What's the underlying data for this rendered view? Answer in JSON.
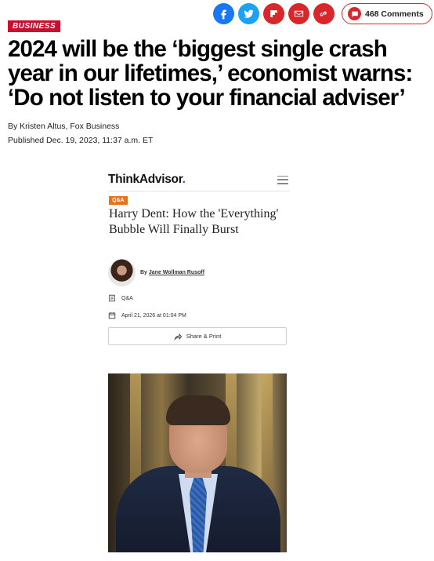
{
  "share_bar": {
    "buttons": [
      {
        "name": "facebook-icon"
      },
      {
        "name": "twitter-icon"
      },
      {
        "name": "flipboard-icon"
      },
      {
        "name": "email-icon"
      },
      {
        "name": "link-icon"
      }
    ],
    "comments_label": "468 Comments",
    "colors": {
      "facebook": "#1877f2",
      "twitter": "#1da1f2",
      "brand_red": "#d9262b"
    }
  },
  "article": {
    "section": "BUSINESS",
    "headline": "2024 will be the ‘biggest single crash year in our lifetimes,’ economist warns: ‘Do not listen to your financial adviser’",
    "byline_prefix": "By ",
    "author": "Kristen Altus",
    "outlet": ", Fox Business",
    "published": "Published Dec. 19, 2023, 11:37 a.m. ET"
  },
  "embed": {
    "logo_text": "ThinkAdvisor",
    "logo_dot": ".",
    "tag": "Q&A",
    "title": "Harry Dent: How the 'Everything' Bubble Will Finally Burst",
    "author_prefix": "By ",
    "author": "Jane Wollman Rusoff",
    "type_label": "Q&A",
    "date_label": "April 21, 2026 at 01:04 PM",
    "share_print_label": "Share & Print",
    "accent_color": "#e8711c"
  }
}
